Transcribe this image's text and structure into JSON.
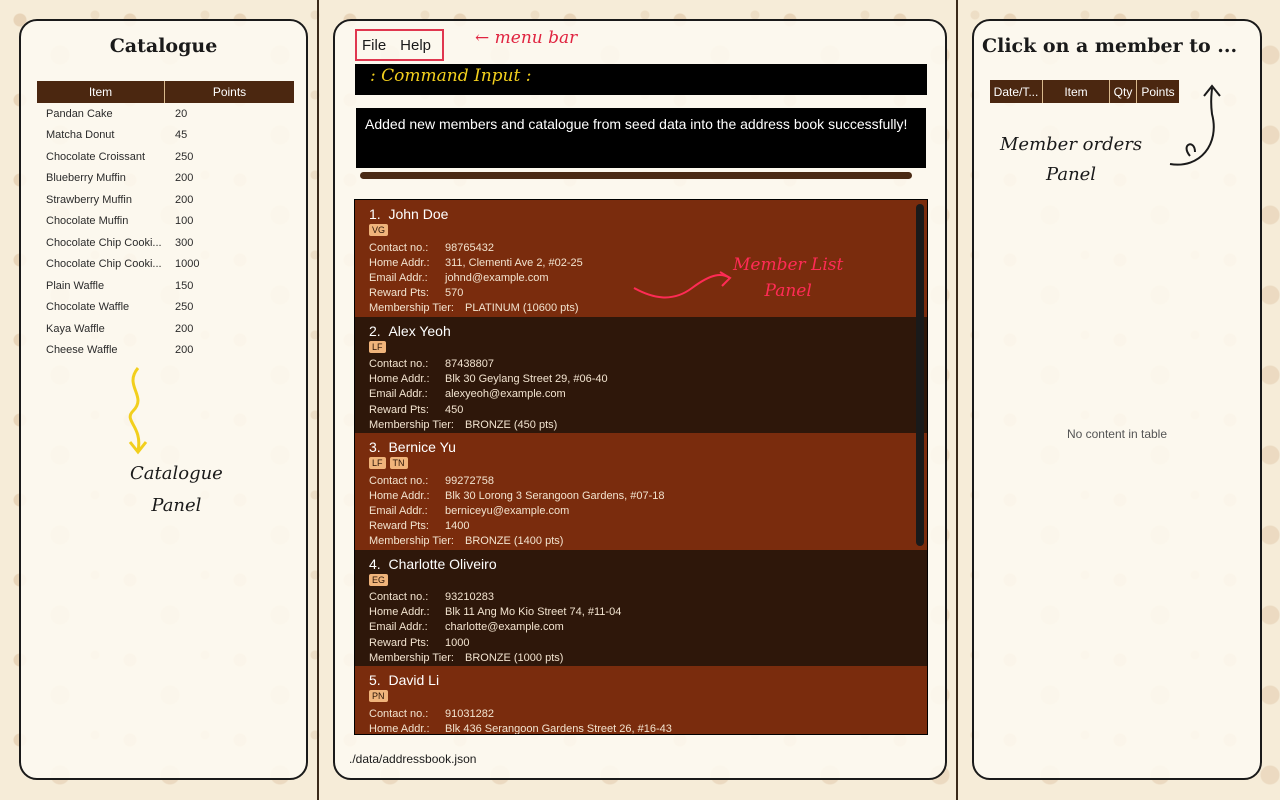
{
  "catalogue": {
    "title": "Catalogue",
    "headers": [
      "Item",
      "Points"
    ],
    "items": [
      {
        "name": "Pandan Cake",
        "points": "20"
      },
      {
        "name": "Matcha Donut",
        "points": "45"
      },
      {
        "name": "Chocolate Croissant",
        "points": "250"
      },
      {
        "name": "Blueberry Muffin",
        "points": "200"
      },
      {
        "name": "Strawberry Muffin",
        "points": "200"
      },
      {
        "name": "Chocolate Muffin",
        "points": "100"
      },
      {
        "name": "Chocolate Chip Cooki...",
        "points": "300"
      },
      {
        "name": "Chocolate Chip Cooki...",
        "points": "1000"
      },
      {
        "name": "Plain Waffle",
        "points": "150"
      },
      {
        "name": "Chocolate Waffle",
        "points": "250"
      },
      {
        "name": "Kaya Waffle",
        "points": "200"
      },
      {
        "name": "Cheese Waffle",
        "points": "200"
      }
    ]
  },
  "menu": {
    "file": "File",
    "help": "Help"
  },
  "command": {
    "value": "",
    "placeholder": ""
  },
  "result": {
    "message": "Added new members and catalogue from seed data into the address book successfully!"
  },
  "labels": {
    "contact": "Contact no.:",
    "home": "Home Addr.:",
    "email": "Email Addr.:",
    "reward": "Reward Pts:",
    "tier": "Membership Tier:"
  },
  "members": [
    {
      "index": "1.",
      "name": "John Doe",
      "tags": [
        "VG"
      ],
      "contact": "98765432",
      "address": "311, Clementi Ave 2, #02-25",
      "email": "johnd@example.com",
      "reward": "570",
      "tier": "PLATINUM (10600 pts)"
    },
    {
      "index": "2.",
      "name": "Alex Yeoh",
      "tags": [
        "LF"
      ],
      "contact": "87438807",
      "address": "Blk 30 Geylang Street 29, #06-40",
      "email": "alexyeoh@example.com",
      "reward": "450",
      "tier": "BRONZE (450 pts)"
    },
    {
      "index": "3.",
      "name": "Bernice Yu",
      "tags": [
        "LF",
        "TN"
      ],
      "contact": "99272758",
      "address": "Blk 30 Lorong 3 Serangoon Gardens, #07-18",
      "email": "berniceyu@example.com",
      "reward": "1400",
      "tier": "BRONZE (1400 pts)"
    },
    {
      "index": "4.",
      "name": "Charlotte Oliveiro",
      "tags": [
        "EG"
      ],
      "contact": "93210283",
      "address": "Blk 11 Ang Mo Kio Street 74, #11-04",
      "email": "charlotte@example.com",
      "reward": "1000",
      "tier": "BRONZE (1000 pts)"
    },
    {
      "index": "5.",
      "name": "David Li",
      "tags": [
        "PN"
      ],
      "contact": "91031282",
      "address": "Blk 436 Serangoon Gardens Street 26, #16-43",
      "email": "",
      "reward": "",
      "tier": ""
    }
  ],
  "status": {
    "path": "./data/addressbook.json"
  },
  "orders": {
    "title": "Click on a member to ...",
    "headers": [
      "Date/T...",
      "Item",
      "Qty",
      "Points"
    ],
    "empty": "No content in table"
  },
  "annotations": {
    "menubar": "← menu bar",
    "command": ": Command Input :",
    "memberlist_line1": "Member List",
    "memberlist_line2": "Panel",
    "catalogue_line1": "Catalogue",
    "catalogue_line2": "Panel",
    "orders_line1": "Member orders",
    "orders_line2": "Panel"
  },
  "colors": {
    "header_brown": "#4b2710",
    "card_odd": "#7a2c0d",
    "card_even": "#2e170a",
    "annotation_red": "#e02440",
    "annotation_yellow": "#f2cf1d",
    "tag": "#f0b47b"
  }
}
